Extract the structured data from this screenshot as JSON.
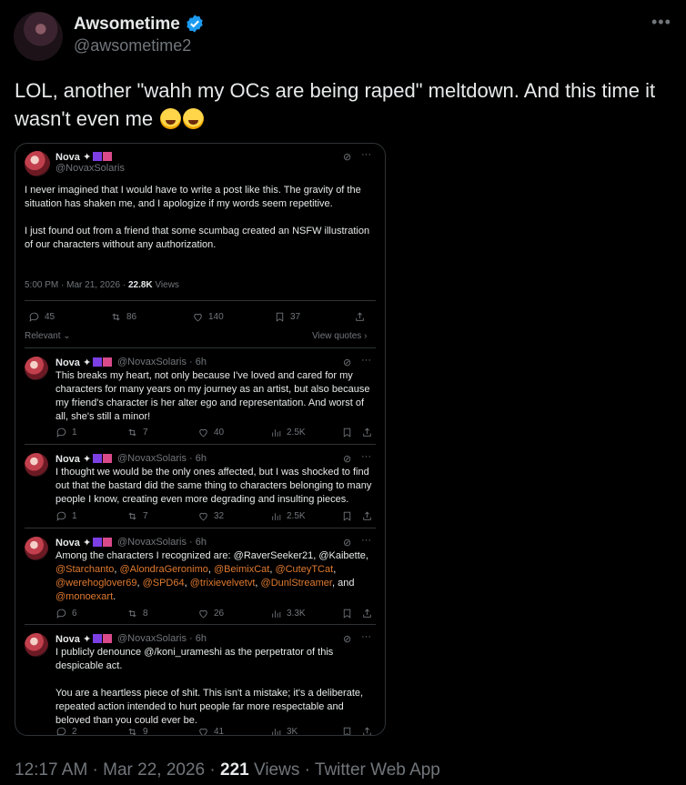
{
  "author": {
    "name": "Awsometime",
    "handle": "@awsometime2",
    "verified": true,
    "more_icon": "more-horizontal-icon"
  },
  "tweet": {
    "text": "LOL, another \"wahh my OCs are being raped\" meltdown. And this time it wasn't even me",
    "emojis": [
      "laughing-crying-emoji",
      "laughing-crying-emoji"
    ],
    "timestamp": "12:17 AM · Mar 22, 2026",
    "separator": "·",
    "views_count": "221",
    "views_label": "Views",
    "source": "· Twitter Web App"
  },
  "embedded": {
    "main_post": {
      "name": "Nova",
      "handle": "@NovaxSolaris",
      "text": "I never imagined that I would have to write a post like this. The gravity of the situation has shaken me, and I apologize if my words seem repetitive.\n\nI just found out from a friend that some scumbag created an NSFW illustration of our characters without any authorization.",
      "time": "5:00 PM · Mar 21, 2026 · ",
      "views_count": "22.8K",
      "views_label": " Views",
      "replies": "45",
      "reposts": "86",
      "likes": "140",
      "bookmarks": "37",
      "relevant_label": "Relevant",
      "view_quotes_label": "View quotes ›"
    },
    "replies": [
      {
        "name": "Nova",
        "handle": "@NovaxSolaris · 6h",
        "text": "This breaks my heart, not only because I've loved and cared for my characters for many years on my journey as an artist, but also because my friend's character is her alter ego and representation. And worst of all, she's still a minor!",
        "replies": "1",
        "reposts": "7",
        "likes": "40",
        "views": "2.5K"
      },
      {
        "name": "Nova",
        "handle": "@NovaxSolaris · 6h",
        "text": "I thought we would be the only ones affected, but I was shocked to find out that the bastard did the same thing to characters belonging to many people I know, creating even more degrading and insulting pieces.",
        "replies": "1",
        "reposts": "7",
        "likes": "32",
        "views": "2.5K"
      },
      {
        "name": "Nova",
        "handle": "@NovaxSolaris · 6h",
        "text_prefix": "Among the characters I recognized are: @RaverSeeker21, @Kaibette,",
        "mentions": [
          "@Starchanto",
          "@AlondraGeronimo",
          "@BeimixCat",
          "@CuteyTCat",
          "@werehoglover69",
          "@SPD64",
          "@trixievelvetvt",
          "@DunlStreamer",
          "@monoexart"
        ],
        "and_word": "and",
        "replies": "6",
        "reposts": "8",
        "likes": "26",
        "views": "3.3K"
      },
      {
        "name": "Nova",
        "handle": "@NovaxSolaris · 6h",
        "text": "I publicly denounce @/koni_urameshi as the perpetrator of this despicable act.\n\nYou are a heartless piece of shit. This isn't a mistake; it's a deliberate, repeated action intended to hurt people far more respectable and beloved than you could ever be.",
        "replies": "2",
        "reposts": "9",
        "likes": "41",
        "views": "3K"
      }
    ]
  }
}
